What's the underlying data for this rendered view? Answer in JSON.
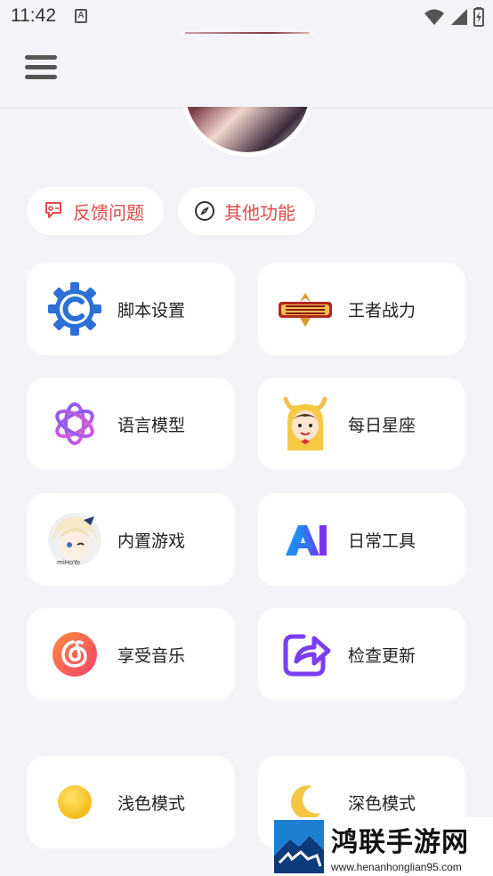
{
  "status": {
    "time": "11:42",
    "notif_letter": "A"
  },
  "actions": [
    {
      "label": "反馈问题",
      "icon": "feedback-icon"
    },
    {
      "label": "其他功能",
      "icon": "compass-icon"
    }
  ],
  "cards": [
    {
      "label": "脚本设置",
      "icon": "gear-c-icon"
    },
    {
      "label": "王者战力",
      "icon": "honor-of-kings-logo-icon"
    },
    {
      "label": "语言模型",
      "icon": "ai-knot-icon"
    },
    {
      "label": "每日星座",
      "icon": "cartoon-mascot-icon"
    },
    {
      "label": "内置游戏",
      "icon": "anime-character-icon"
    },
    {
      "label": "日常工具",
      "icon": "letter-a-logo-icon"
    },
    {
      "label": "享受音乐",
      "icon": "netease-music-icon"
    },
    {
      "label": "检查更新",
      "icon": "share-update-icon"
    },
    {
      "label": "浅色模式",
      "icon": "sun-icon"
    },
    {
      "label": "深色模式",
      "icon": "moon-icon"
    }
  ],
  "watermark": {
    "title": "鸿联手游网",
    "url": "www.henanhonglian95.com"
  },
  "colors": {
    "accent_red": "#e04a4a",
    "background": "#f4f4f8",
    "card": "#ffffff"
  }
}
